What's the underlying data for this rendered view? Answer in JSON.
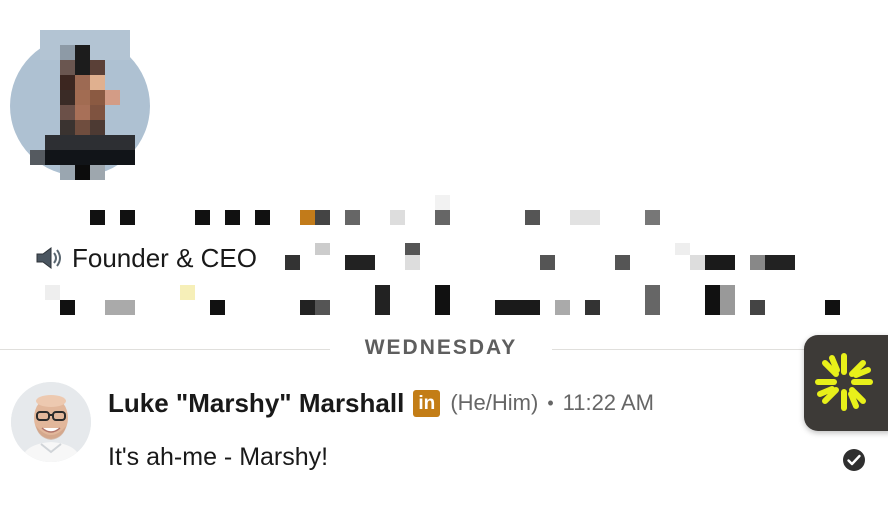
{
  "profile": {
    "headline": "Founder & CEO",
    "headline_icon": "speaker-icon"
  },
  "divider": {
    "day_label": "WEDNESDAY"
  },
  "message": {
    "sender_name": "Luke \"Marshy\" Marshall",
    "badge_text": "in",
    "pronouns": "(He/Him)",
    "separator": "•",
    "time": "11:22 AM",
    "body": "It's ah-me - Marshy!",
    "status_icon": "read-check-icon"
  },
  "colors": {
    "linkedin_badge": "#c37d16",
    "day_label": "#5e5e5e",
    "brand_widget_bg": "#3d3a37",
    "brand_burst": "#e8f01a"
  }
}
